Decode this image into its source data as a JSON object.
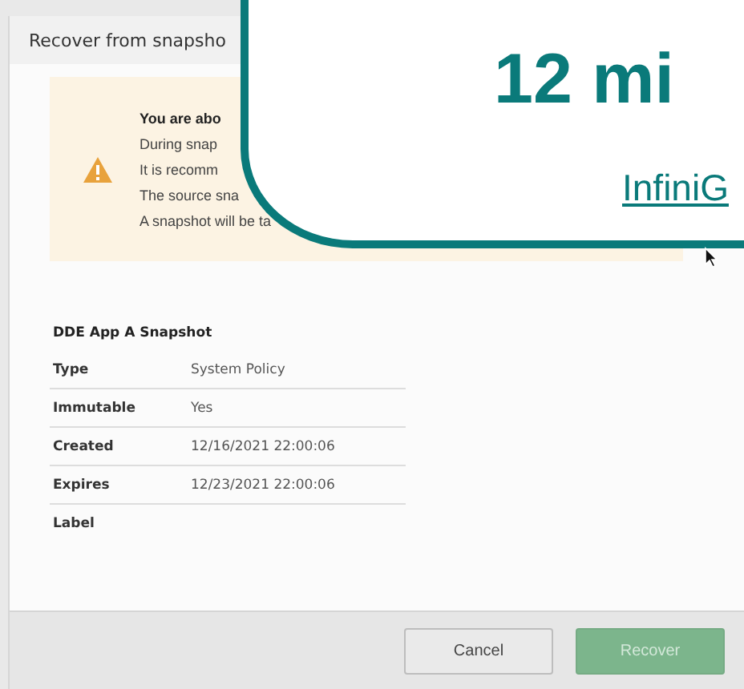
{
  "dialog": {
    "title": "Recover from snapsho",
    "warning": {
      "heading": "You are abo",
      "lines": [
        "During snap",
        "It is recomm",
        "The source sna",
        "A snapshot will be ta"
      ]
    },
    "details": {
      "title": "DDE App A Snapshot",
      "rows": [
        {
          "label": "Type",
          "value": "System Policy"
        },
        {
          "label": "Immutable",
          "value": "Yes"
        },
        {
          "label": "Created",
          "value": "12/16/2021 22:00:06"
        },
        {
          "label": "Expires",
          "value": "12/23/2021 22:00:06"
        },
        {
          "label": "Label",
          "value": ""
        }
      ]
    },
    "buttons": [
      {
        "label": "Cancel",
        "kind": "secondary",
        "disabled": false
      },
      {
        "label": "Recover",
        "kind": "primary",
        "disabled": true
      }
    ]
  },
  "overlay": {
    "headline": "12 mi",
    "link": "InfiniG"
  }
}
